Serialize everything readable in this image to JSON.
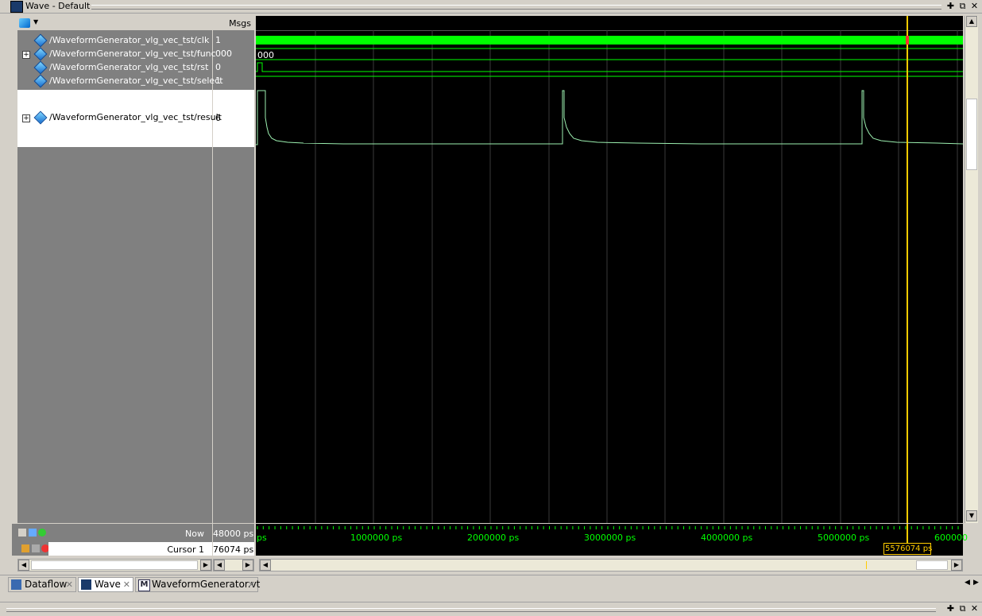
{
  "window": {
    "title": "Wave - Default"
  },
  "headers": {
    "msgs": "Msgs"
  },
  "signals": [
    {
      "name": "/WaveformGenerator_vlg_vec_tst/clk",
      "value": "1",
      "expandable": false
    },
    {
      "name": "/WaveformGenerator_vlg_vec_tst/func",
      "value": "000",
      "expandable": true
    },
    {
      "name": "/WaveformGenerator_vlg_vec_tst/rst",
      "value": "0",
      "expandable": false
    },
    {
      "name": "/WaveformGenerator_vlg_vec_tst/select",
      "value": "1",
      "expandable": false
    },
    {
      "name": "/WaveformGenerator_vlg_vec_tst/result",
      "value": "6",
      "expandable": true
    }
  ],
  "wave": {
    "func_bus_label": "000"
  },
  "status": {
    "now_label": "Now",
    "now_value": "48000 ps",
    "cursor_label": "Cursor 1",
    "cursor_value": "76074 ps",
    "cursor_marker": "5576074 ps"
  },
  "ruler": {
    "start": "ps",
    "ticks": [
      "1000000 ps",
      "2000000 ps",
      "3000000 ps",
      "4000000 ps",
      "5000000 ps",
      "600000"
    ]
  },
  "tabs": [
    {
      "label": "Dataflow",
      "icon": "dataflow-icon",
      "active": false
    },
    {
      "label": "Wave",
      "icon": "wave-icon",
      "active": true
    },
    {
      "label": "WaveformGenerator.vt",
      "icon": "verilog-file-icon",
      "active": false
    }
  ],
  "colors": {
    "signal": "#00ff00",
    "cursor": "#ffcc00",
    "background": "#000000"
  }
}
